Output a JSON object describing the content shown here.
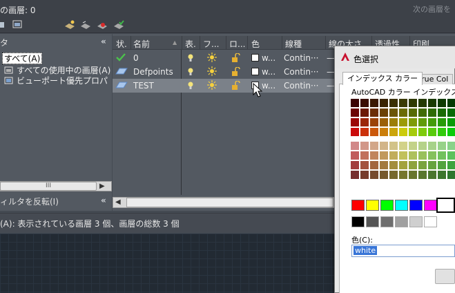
{
  "header": {
    "current_layer": "の画層: 0",
    "next_hint": "次の画層を"
  },
  "filter_panel": {
    "title": "タ",
    "tree": [
      "すべて(A)",
      "すべての使用中の画層(A)",
      "ビューポート優先プロパ"
    ],
    "scroll_thumb": "III",
    "invert_label": "ィルタを反転(I)"
  },
  "layer_table": {
    "columns": [
      "状.",
      "名前",
      "表.",
      "フ...",
      "ロ...",
      "色",
      "線種",
      "線の太さ",
      "透過性",
      "印刷..."
    ],
    "rows": [
      {
        "name": "0",
        "color": "w...",
        "linetype": "Contin···",
        "lineweight": "—"
      },
      {
        "name": "Defpoints",
        "color": "w...",
        "linetype": "Contin···",
        "lineweight": "—"
      },
      {
        "name": "TEST",
        "color": "w...",
        "linetype": "Contin···",
        "lineweight": "—"
      }
    ]
  },
  "status": {
    "text": "(A): 表示されている画層 3 個、画層の総数 3 個"
  },
  "color_dialog": {
    "title": "色選択",
    "tabs": [
      "インデックス カラー",
      "True Col"
    ],
    "aci_label": "AutoCAD カラー インデックス(AC",
    "color_label": "色(C):",
    "color_value": "white",
    "palette_colors": {
      "red": "#ff0000",
      "yellow": "#ffff00",
      "green": "#00ff00",
      "cyan": "#00ffff",
      "blue": "#0000ff",
      "magenta": "#ff00ff",
      "white": "#ffffff"
    }
  }
}
